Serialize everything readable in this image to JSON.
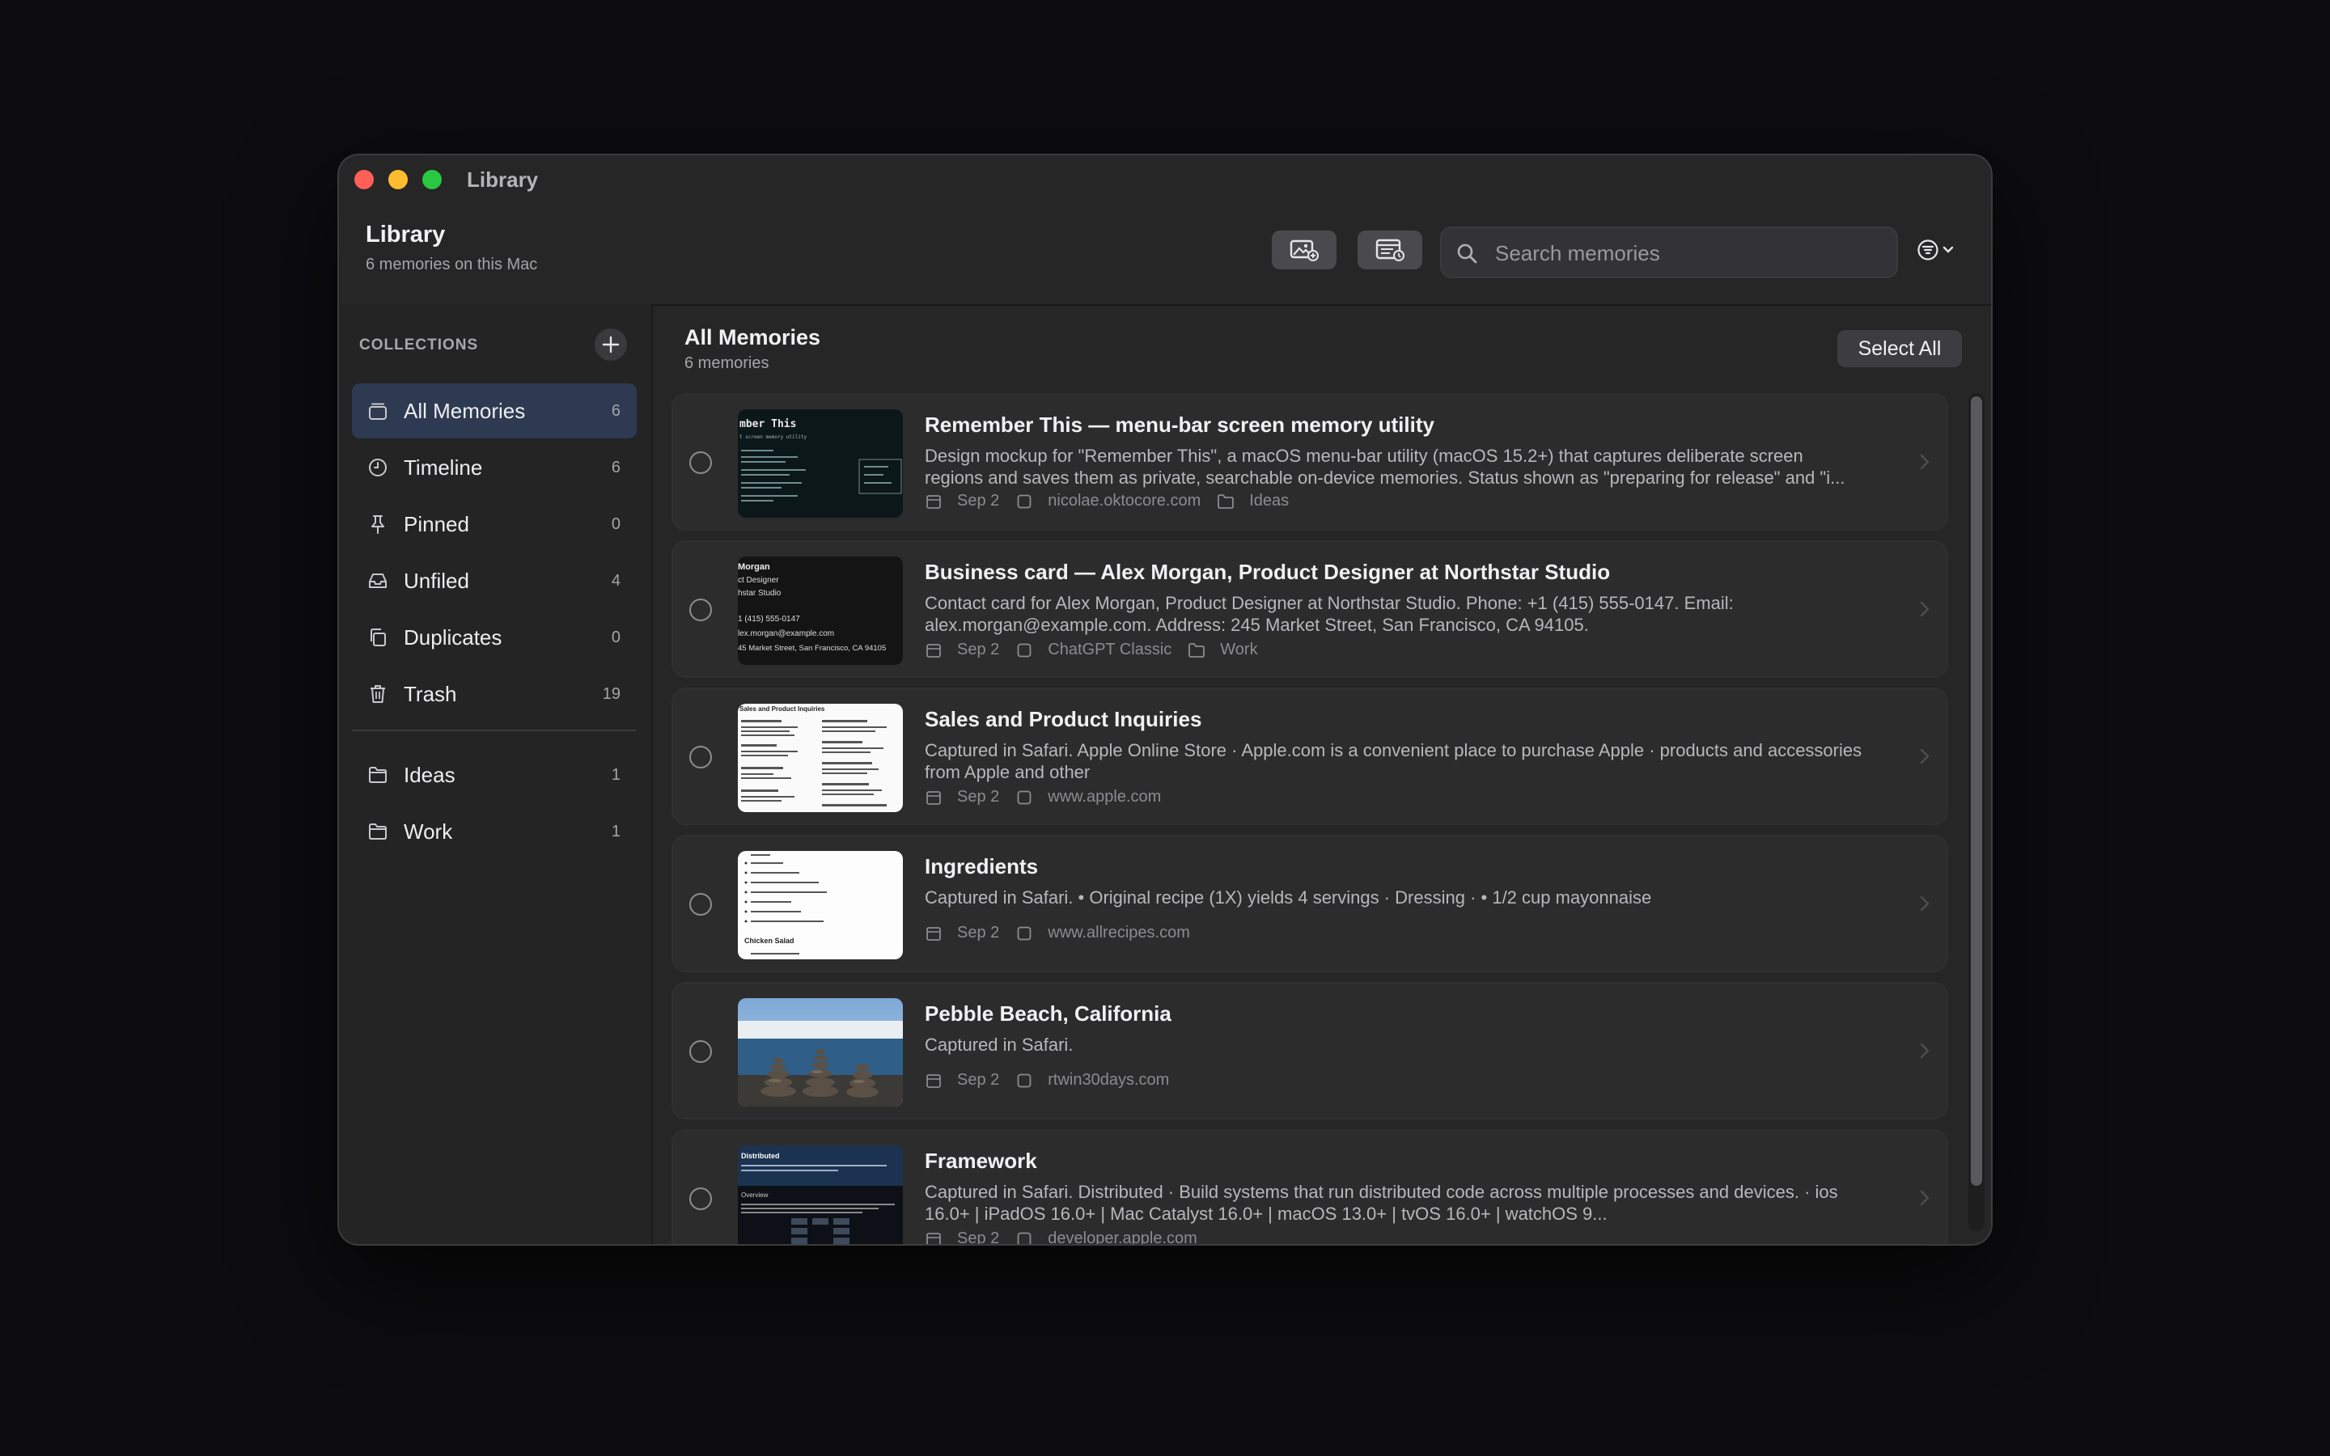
{
  "window": {
    "title": "Library"
  },
  "header": {
    "title": "Library",
    "subtitle": "6 memories on this Mac",
    "search_placeholder": "Search memories",
    "buttons": [
      "add-image-icon",
      "capture-screen-icon",
      "filter-icon"
    ]
  },
  "sidebar": {
    "section_label": "COLLECTIONS",
    "items": [
      {
        "label": "All Memories",
        "count": "6",
        "icon": "stack-icon",
        "active": true
      },
      {
        "label": "Timeline",
        "count": "6",
        "icon": "clock-icon"
      },
      {
        "label": "Pinned",
        "count": "0",
        "icon": "pin-icon"
      },
      {
        "label": "Unfiled",
        "count": "4",
        "icon": "tray-icon"
      },
      {
        "label": "Duplicates",
        "count": "0",
        "icon": "duplicate-icon"
      },
      {
        "label": "Trash",
        "count": "19",
        "icon": "trash-icon"
      }
    ],
    "folders": [
      {
        "label": "Ideas",
        "count": "1",
        "icon": "folder-icon"
      },
      {
        "label": "Work",
        "count": "1",
        "icon": "folder-icon"
      }
    ]
  },
  "main": {
    "title": "All Memories",
    "subtitle": "6 memories",
    "select_all_label": "Select All",
    "memories": [
      {
        "title": "Remember This — menu-bar screen memory utility",
        "description": "Design mockup for \"Remember This\", a macOS menu-bar utility (macOS 15.2+) that captures deliberate screen regions and saves them as private, searchable on-device memories. Status shown as \"preparing for release\" and \"i...",
        "date": "Sep 2",
        "source": "nicolae.oktocore.com",
        "collection": "Ideas",
        "thumb_text": [
          "mber This",
          "t screen memory utility"
        ]
      },
      {
        "title": "Business card — Alex Morgan, Product Designer at Northstar Studio",
        "description": "Contact card for Alex Morgan, Product Designer at Northstar Studio. Phone: +1 (415) 555-0147. Email: alex.morgan@example.com. Address: 245 Market Street, San Francisco, CA 94105.",
        "date": "Sep 2",
        "source": "ChatGPT Classic",
        "collection": "Work",
        "thumb_text": [
          "Morgan",
          "ct Designer",
          "hstar Studio",
          "1 (415) 555-0147",
          "lex.morgan@example.com",
          "45 Market Street, San Francisco, CA 94105"
        ]
      },
      {
        "title": "Sales and Product Inquiries",
        "description": "Captured in Safari. Apple Online Store · Apple.com is a convenient place to purchase Apple · products and accessories from Apple and other",
        "date": "Sep 2",
        "source": "www.apple.com",
        "collection": "",
        "thumb_text": [
          "Sales and Product Inquiries"
        ]
      },
      {
        "title": "Ingredients",
        "description": "Captured in Safari. • Original recipe (1X) yields 4 servings · Dressing · • 1/2 cup mayonnaise",
        "date": "Sep 2",
        "source": "www.allrecipes.com",
        "collection": "",
        "thumb_text": [
          "Chicken Salad"
        ]
      },
      {
        "title": "Pebble Beach, California",
        "description": "Captured in Safari.",
        "date": "Sep 2",
        "source": "rtwin30days.com",
        "collection": "",
        "thumb_text": []
      },
      {
        "title": "Framework",
        "description": "Captured in Safari. Distributed · Build systems that run distributed code across multiple processes and devices. · ios 16.0+ | iPadOS 16.0+ | Mac Catalyst 16.0+ | macOS 13.0+ | tvOS 16.0+ | watchOS 9...",
        "date": "Sep 2",
        "source": "developer.apple.com",
        "collection": "",
        "thumb_text": [
          "Distributed",
          "Overview"
        ]
      }
    ]
  },
  "colors": {
    "accent_active_bg": "#2d3a52",
    "window_bg": "#262627",
    "row_bg": "#2c2c2d"
  }
}
